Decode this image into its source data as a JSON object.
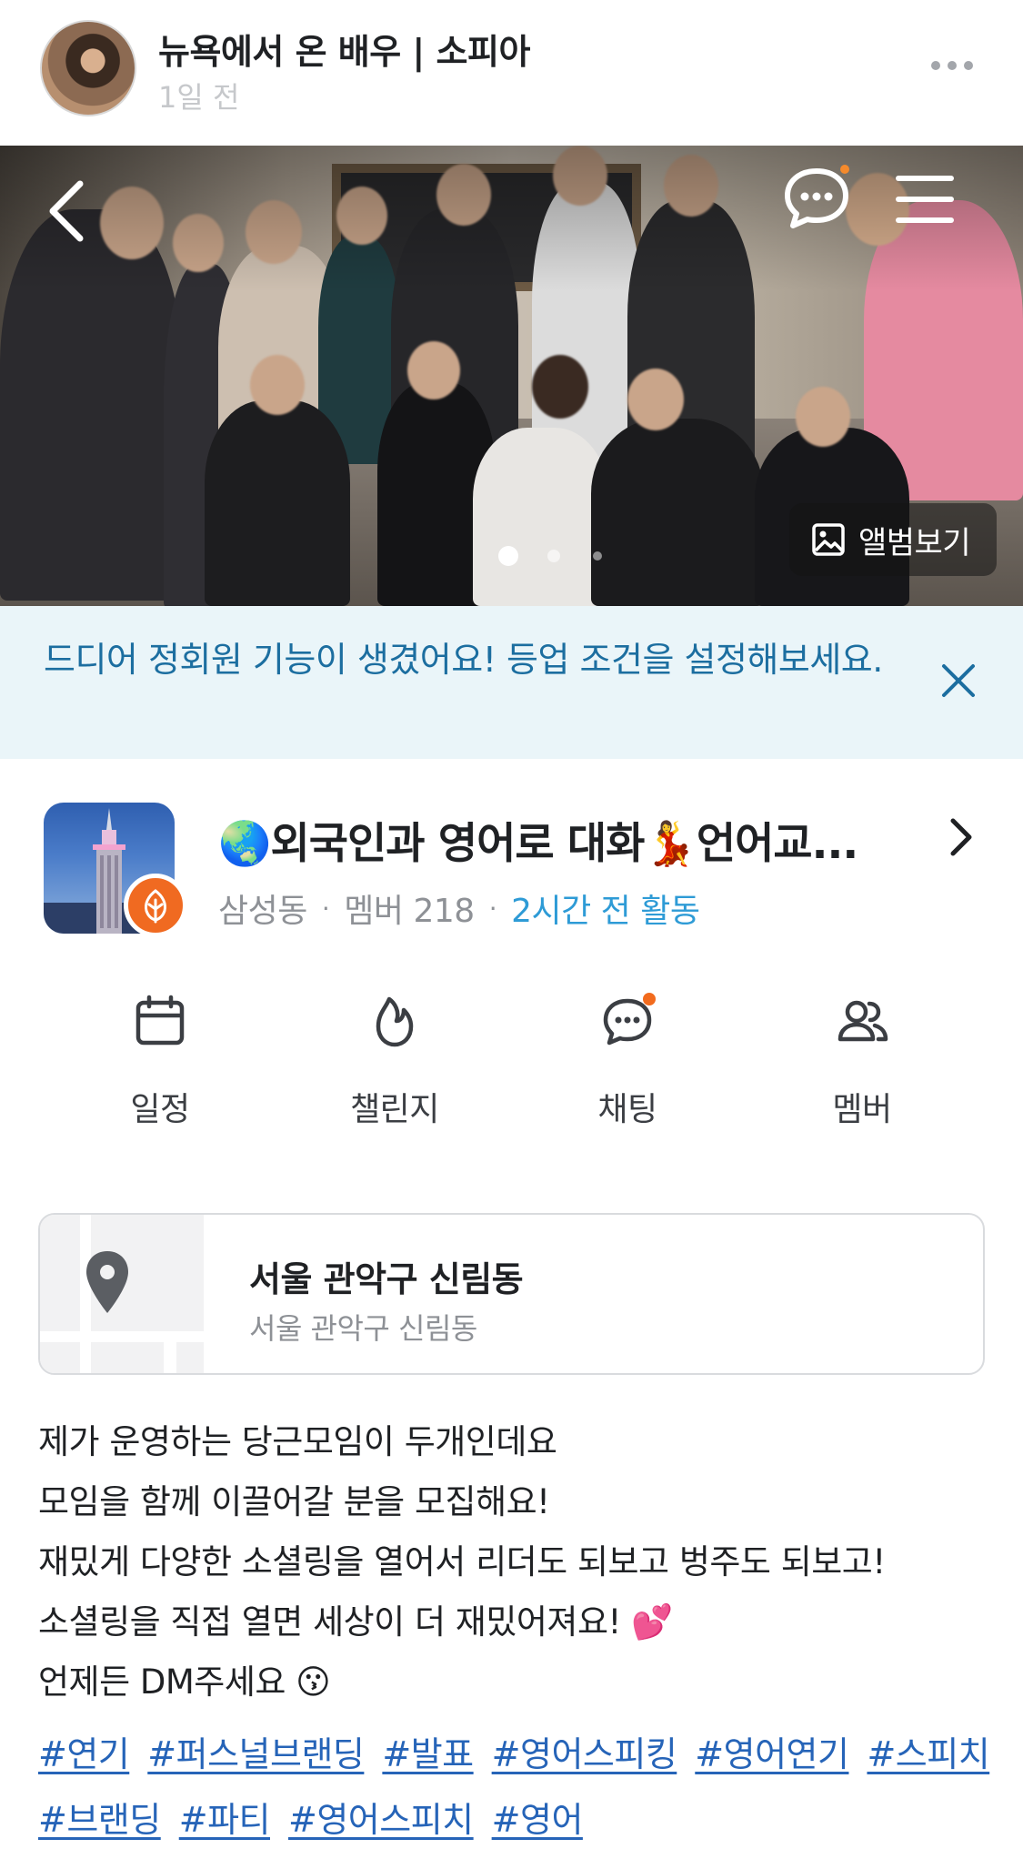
{
  "header": {
    "author_name": "뉴욕에서 온 배우 | 소피아",
    "time_ago": "1일 전",
    "more_icon": "more-horizontal-icon"
  },
  "photo": {
    "album_label": "앨범보기",
    "page_index": 1,
    "page_count": 3,
    "icons": [
      "back-chevron-icon",
      "chat-bubble-icon",
      "hamburger-menu-icon",
      "image-icon"
    ]
  },
  "notice": {
    "text": "드디어 정회원 기능이 생겼어요! 등업 조건을 설정해보세요.",
    "close_icon": "close-icon"
  },
  "group": {
    "title": "🌏외국인과 영어로 대화💃언어교...",
    "location": "삼성동",
    "members": "멤버 218",
    "activity": "2시간 전 활동"
  },
  "actions": [
    {
      "label": "일정",
      "icon": "calendar-icon"
    },
    {
      "label": "챌린지",
      "icon": "flame-icon"
    },
    {
      "label": "채팅",
      "icon": "chat-icon",
      "has_new_dot": true
    },
    {
      "label": "멤버",
      "icon": "members-icon"
    }
  ],
  "location_card": {
    "title": "서울 관악구 신림동",
    "subtitle": "서울 관악구 신림동",
    "icon": "map-pin-icon"
  },
  "body": {
    "lines": [
      "제가 운영하는 당근모임이 두개인데요",
      "모임을 함께 이끌어갈 분을 모집해요!",
      "재밌게 다양한 소셜링을 열어서 리더도 되보고 벙주도 되보고!",
      "소셜링을 직접 열면 세상이 더 재밌어져요! 💕",
      "언제든 DM주세요 😗"
    ],
    "tags_row1": [
      "#연기",
      "#퍼스널브랜딩",
      "#발표",
      "#영어스피킹",
      "#영어연기",
      "#스피치"
    ],
    "tags_row2": [
      "#브랜딩",
      "#파티",
      "#영어스피치",
      "#영어"
    ]
  },
  "colors": {
    "notice_bg": "#eaf5f9",
    "notice_text": "#1c6ea0",
    "activity_blue": "#2e9bd6",
    "tag_blue": "#2664b8",
    "badge_orange": "#f06a21"
  }
}
